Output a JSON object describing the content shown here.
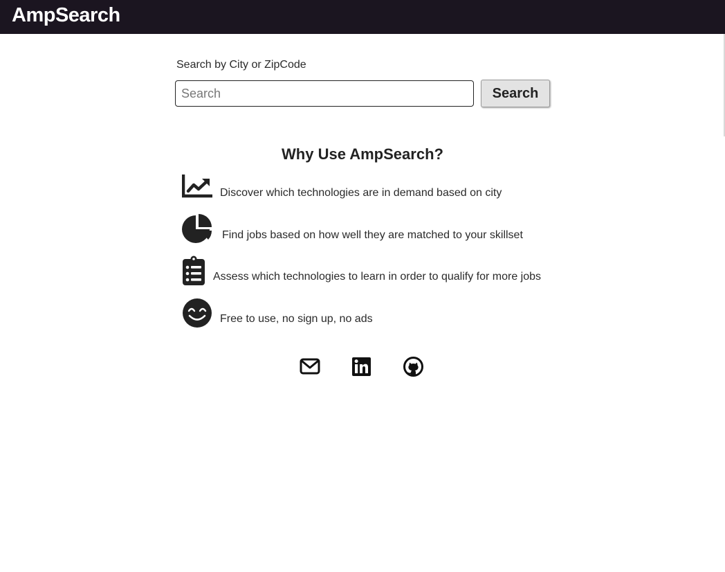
{
  "header": {
    "brand": "AmpSearch"
  },
  "search": {
    "label": "Search by City or ZipCode",
    "placeholder": "Search",
    "value": "",
    "button_label": "Search"
  },
  "features": {
    "title": "Why Use AmpSearch?",
    "items": [
      {
        "icon": "chart-line-icon",
        "text": "Discover which technologies are in demand based on city"
      },
      {
        "icon": "pie-chart-icon",
        "text": "Find jobs based on how well they are matched to your skillset"
      },
      {
        "icon": "clipboard-list-icon",
        "text": "Assess which technologies to learn in order to qualify for more jobs"
      },
      {
        "icon": "smile-icon",
        "text": "Free to use, no sign up, no ads"
      }
    ]
  },
  "social": [
    {
      "icon": "envelope-icon"
    },
    {
      "icon": "linkedin-icon"
    },
    {
      "icon": "github-icon"
    }
  ],
  "colors": {
    "navbar": "#1b1520",
    "brand_text": "#ffffff",
    "button_bg": "#e3e3e3",
    "icon": "#222222"
  }
}
